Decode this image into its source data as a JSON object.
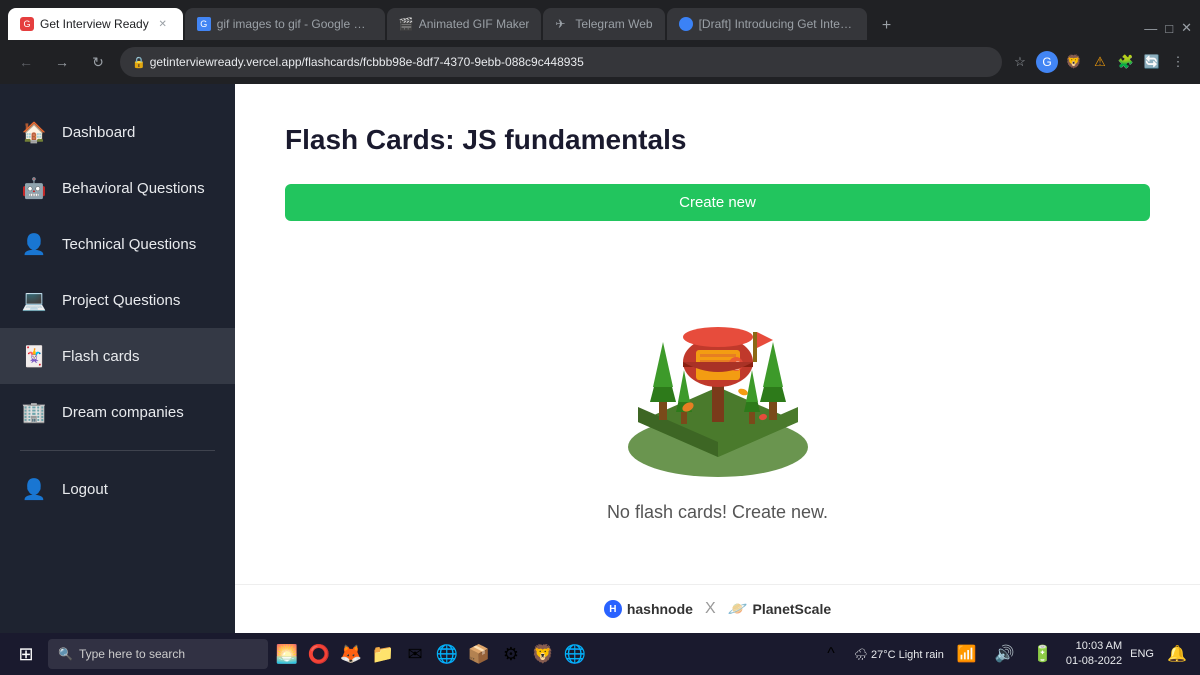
{
  "browser": {
    "tabs": [
      {
        "id": "tab1",
        "favicon": "🎯",
        "label": "Get Interview Ready",
        "active": true,
        "closable": true
      },
      {
        "id": "tab2",
        "favicon": "🌐",
        "label": "gif images to gif - Google Search",
        "active": false,
        "closable": false
      },
      {
        "id": "tab3",
        "favicon": "🎬",
        "label": "Animated GIF Maker",
        "active": false,
        "closable": false
      },
      {
        "id": "tab4",
        "favicon": "✈",
        "label": "Telegram Web",
        "active": false,
        "closable": false
      },
      {
        "id": "tab5",
        "favicon": "🔵",
        "label": "[Draft] Introducing Get Interview Rea...",
        "active": false,
        "closable": false
      }
    ],
    "address": "getinterviewready.vercel.app/flashcards/fcbbb98e-8df7-4370-9ebb-088c9c448935",
    "new_tab_label": "+"
  },
  "sidebar": {
    "items": [
      {
        "id": "dashboard",
        "label": "Dashboard",
        "icon": "🏠",
        "active": false
      },
      {
        "id": "behavioral",
        "label": "Behavioral Questions",
        "icon": "🤖",
        "active": false
      },
      {
        "id": "technical",
        "label": "Technical Questions",
        "icon": "👤",
        "active": false
      },
      {
        "id": "project",
        "label": "Project Questions",
        "icon": "💻",
        "active": false
      },
      {
        "id": "flashcards",
        "label": "Flash cards",
        "icon": "🃏",
        "active": true
      },
      {
        "id": "dream",
        "label": "Dream companies",
        "icon": "🏢",
        "active": false
      }
    ],
    "logout_label": "Logout",
    "logout_icon": "👤"
  },
  "main": {
    "page_title": "Flash Cards: JS fundamentals",
    "create_button": "Create new",
    "empty_state_text": "No flash cards! Create new."
  },
  "footer": {
    "brand1": "hashnode",
    "separator": "X",
    "brand2": "PlanetScale"
  },
  "taskbar": {
    "search_placeholder": "Type here to search",
    "weather": "27°C  Light rain",
    "lang": "ENG",
    "time": "10:03 AM",
    "date": "01-08-2022"
  }
}
